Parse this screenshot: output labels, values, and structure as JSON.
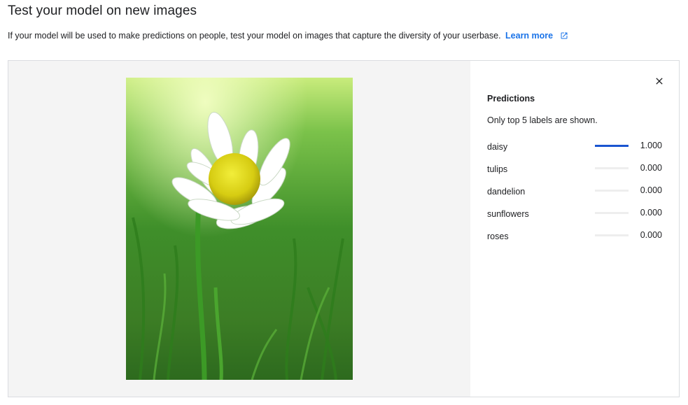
{
  "page": {
    "title": "Test your model on new images",
    "subtitle": "If your model will be used to make predictions on people, test your model on images that capture the diversity of your userbase.",
    "learn_more": "Learn more",
    "learn_more_icon": "open-in-new-icon"
  },
  "preview": {
    "image_alt": "white daisy flower in green grass",
    "close_icon": "close-icon"
  },
  "predictions": {
    "title": "Predictions",
    "note": "Only top 5 labels are shown.",
    "bar_color": "#1a55d0",
    "items": [
      {
        "label": "daisy",
        "score": "1.000",
        "value": 1.0
      },
      {
        "label": "tulips",
        "score": "0.000",
        "value": 0.0
      },
      {
        "label": "dandelion",
        "score": "0.000",
        "value": 0.0
      },
      {
        "label": "sunflowers",
        "score": "0.000",
        "value": 0.0
      },
      {
        "label": "roses",
        "score": "0.000",
        "value": 0.0
      }
    ]
  },
  "colors": {
    "link": "#1a73e8",
    "panel_bg": "#f4f4f4",
    "border": "#dadce0"
  }
}
